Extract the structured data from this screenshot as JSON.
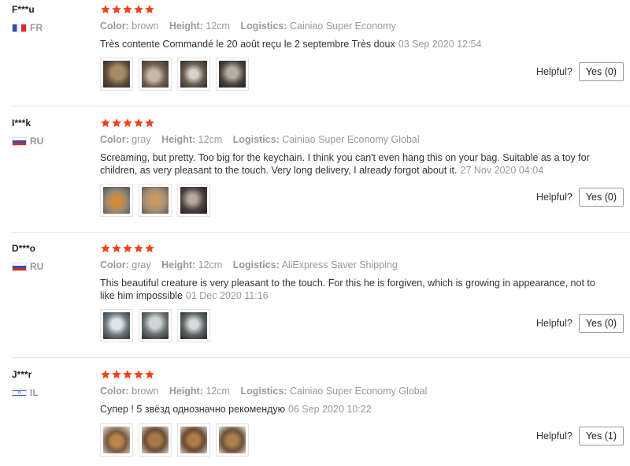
{
  "labels": {
    "color": "Color:",
    "height": "Height:",
    "logistics": "Logistics:",
    "helpful": "Helpful?"
  },
  "star_color": "#f0421e",
  "reviews": [
    {
      "user": "F***u",
      "country_code": "FR",
      "flag": "flag-fr-icon",
      "rating": 5,
      "color": "brown",
      "height": "12cm",
      "logistics": "Cainiao Super Economy",
      "content": "Très contente Commandé le 20 août reçu le 2 septembre Très doux",
      "date": "03 Sep 2020 12:54",
      "helpful": "Yes (0)",
      "photo_count": 4
    },
    {
      "user": "I***k",
      "country_code": "RU",
      "flag": "flag-ru-icon",
      "rating": 5,
      "color": "gray",
      "height": "12cm",
      "logistics": "Cainiao Super Economy Global",
      "content": "Screaming, but pretty. Too big for the keychain. I think you can't even hang this on your bag. Suitable as a toy for children, as very pleasant to the touch. Very long delivery, I already forgot about it.",
      "date": "27 Nov 2020 04:04",
      "helpful": "Yes (0)",
      "photo_count": 3
    },
    {
      "user": "D***o",
      "country_code": "RU",
      "flag": "flag-ru-icon",
      "rating": 5,
      "color": "gray",
      "height": "12cm",
      "logistics": "AliExpress Saver Shipping",
      "content": "This beautiful creature is very pleasant to the touch. For this he is forgiven, which is growing in appearance, not to like him impossible",
      "date": "01 Dec 2020 11:16",
      "helpful": "Yes (0)",
      "photo_count": 3
    },
    {
      "user": "J***r",
      "country_code": "IL",
      "flag": "flag-il-icon",
      "rating": 5,
      "color": "brown",
      "height": "12cm",
      "logistics": "Cainiao Super Economy Global",
      "content": "Супер ! 5 звёзд однозначно рекомендую",
      "date": "06 Sep 2020 10:22",
      "helpful": "Yes (1)",
      "photo_count": 4
    }
  ]
}
